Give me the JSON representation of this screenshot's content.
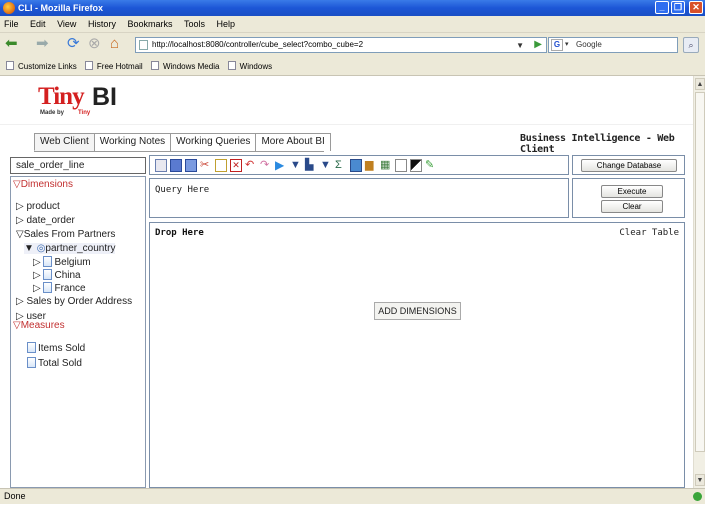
{
  "window": {
    "title": "CLI - Mozilla Firefox",
    "min": "_",
    "max": "❐",
    "close": "✕"
  },
  "menu": [
    "File",
    "Edit",
    "View",
    "History",
    "Bookmarks",
    "Tools",
    "Help"
  ],
  "nav": {
    "url": "http://localhost:8080/controller/cube_select?combo_cube=2",
    "search_placeholder": "Google"
  },
  "bookmarks": [
    "Customize Links",
    "Free Hotmail",
    "Windows Media",
    "Windows"
  ],
  "app": {
    "logo_tiny": "Tiny",
    "logo_bi": "BI",
    "made_by": "Made by",
    "made_by_tiny": "Tiny",
    "tabs": [
      "Web Client",
      "Working Notes",
      "Working Queries",
      "More About BI"
    ],
    "title": "Business Intelligence - Web Client",
    "cube": "sale_order_line",
    "change_db": "Change Database",
    "query_placeholder": "Query Here",
    "execute": "Execute",
    "clear": "Clear",
    "drop_here": "Drop Here",
    "clear_table": "Clear Table",
    "add_dimensions": "ADD DIMENSIONS"
  },
  "dimensions": {
    "heading": "Dimensions",
    "items": [
      "product",
      "date_order",
      "Sales From Partners",
      "Sales by Order Address",
      "user"
    ],
    "expanded_child": "partner_country",
    "countries": [
      "Belgium",
      "China",
      "France"
    ]
  },
  "measures": {
    "heading": "Measures",
    "items": [
      "Items Sold",
      "Total Sold"
    ]
  },
  "status": {
    "text": "Done"
  },
  "colors": {
    "accent_red": "#c23030",
    "titlebar_blue": "#1c56d6"
  }
}
